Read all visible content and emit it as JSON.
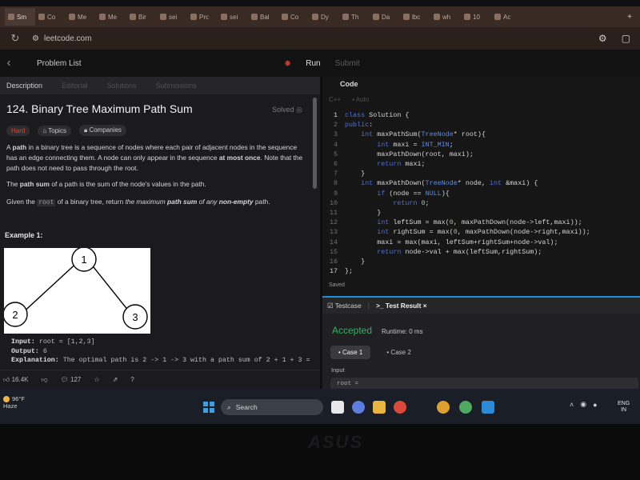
{
  "browser": {
    "tabs": [
      "Sm",
      "Co",
      "Me",
      "Me",
      "Bir",
      "sei",
      "Prc",
      "sei",
      "Bal",
      "Co",
      "Dy",
      "Th",
      "Da",
      "lbc",
      "wh",
      "10",
      "Ac"
    ],
    "url": "leetcode.com"
  },
  "lc_top": {
    "problem_list": "Problem List",
    "run": "Run",
    "submit": "Submit"
  },
  "left": {
    "tabs": [
      "Description",
      "Editorial",
      "Solutions",
      "Submissions"
    ],
    "title": "124. Binary Tree Maximum Path Sum",
    "solved": "Solved",
    "difficulty": "Hard",
    "topics": "Topics",
    "companies": "Companies",
    "desc1_pre": "A ",
    "desc1_bold": "path",
    "desc1_mid": " in a binary tree is a sequence of nodes where each pair of adjacent nodes in the sequence has an edge connecting them. A node can only appear in the sequence ",
    "desc1_bold2": "at most once",
    "desc1_post": ". Note that the path does not need to pass through the root.",
    "desc2_pre": "The ",
    "desc2_bold": "path sum",
    "desc2_post": " of a path is the sum of the node's values in the path.",
    "desc3_pre": "Given the ",
    "desc3_code": "root",
    "desc3_mid": " of a binary tree, return ",
    "desc3_it": "the maximum ",
    "desc3_bold": "path sum",
    "desc3_it2": " of any ",
    "desc3_bold2": "non-empty",
    "desc3_post": " path.",
    "example_title": "Example 1:",
    "tree_nodes": [
      "1",
      "2",
      "3"
    ],
    "ex_input_label": "Input:",
    "ex_input": " root = [1,2,3]",
    "ex_output_label": "Output:",
    "ex_output": " 6",
    "ex_expl_label": "Explanation:",
    "ex_expl": " The optimal path is 2 -> 1 -> 3 with a path sum of 2 + 1 + 3 =",
    "likes": "16.4K",
    "comments": "127"
  },
  "right": {
    "code_title": "Code",
    "lang": "C++",
    "auto": "Auto",
    "code_lines": [
      {
        "n": "1",
        "t": "class Solution {"
      },
      {
        "n": "2",
        "t": "public:"
      },
      {
        "n": "3",
        "t": "    int maxPathSum(TreeNode* root){"
      },
      {
        "n": "4",
        "t": "        int maxi = INT_MIN;"
      },
      {
        "n": "5",
        "t": "        maxPathDown(root, maxi);"
      },
      {
        "n": "6",
        "t": "        return maxi;"
      },
      {
        "n": "7",
        "t": "    }"
      },
      {
        "n": "8",
        "t": "    int maxPathDown(TreeNode* node, int &maxi) {"
      },
      {
        "n": "9",
        "t": "        if (node == NULL){"
      },
      {
        "n": "10",
        "t": "            return 0;"
      },
      {
        "n": "11",
        "t": "        }"
      },
      {
        "n": "12",
        "t": "        int leftSum = max(0, maxPathDown(node->left,maxi));"
      },
      {
        "n": "13",
        "t": "        int rightSum = max(0, maxPathDown(node->right,maxi));"
      },
      {
        "n": "14",
        "t": "        maxi = max(maxi, leftSum+rightSum+node->val);"
      },
      {
        "n": "15",
        "t": "        return node->val + max(leftSum,rightSum);"
      },
      {
        "n": "16",
        "t": "    }"
      },
      {
        "n": "17",
        "t": "};"
      }
    ],
    "saved": "Saved",
    "tab_testcase": "Testcase",
    "tab_result": "Test Result",
    "accepted": "Accepted",
    "runtime": "Runtime: 0 ms",
    "cases": [
      "Case 1",
      "Case 2"
    ],
    "input_label": "Input",
    "input_value": "root ="
  },
  "taskbar": {
    "temp": "96°F",
    "weather": "Haze",
    "search": "Search",
    "lang1": "ENG",
    "lang2": "IN"
  },
  "bezel": {
    "brand": "ASUS"
  },
  "colors": {
    "accepted": "#2db55d",
    "hard": "#d8443a",
    "keyword": "#4f6fd6",
    "accent": "#1d8fd8"
  }
}
